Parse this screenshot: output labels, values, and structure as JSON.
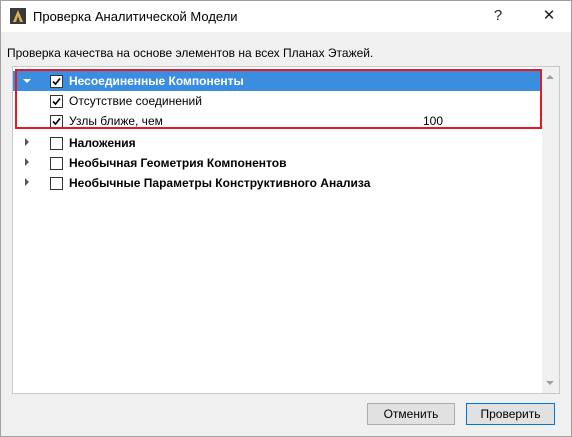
{
  "window": {
    "title": "Проверка Аналитической Модели",
    "help_label": "?",
    "close_label": "✕",
    "app_icon": "archicad-logo-icon"
  },
  "description": "Проверка качества на основе элементов на всех Планах Этажей.",
  "tree": {
    "items": [
      {
        "label": "Несоединенные Компоненты",
        "checked": true,
        "expanded": true,
        "selected": true
      },
      {
        "label": "Отсутствие соединений",
        "checked": true
      },
      {
        "label": "Узлы ближе, чем",
        "checked": true,
        "value": "100"
      },
      {
        "label": "Наложения",
        "checked": false,
        "expanded": false
      },
      {
        "label": "Необычная Геометрия Компонентов",
        "checked": false,
        "expanded": false
      },
      {
        "label": "Необычные Параметры Конструктивного Анализа",
        "checked": false,
        "expanded": false
      }
    ]
  },
  "buttons": {
    "cancel": "Отменить",
    "check": "Проверить"
  },
  "colors": {
    "selection": "#3b8de0",
    "highlight_border": "#e01b24"
  }
}
